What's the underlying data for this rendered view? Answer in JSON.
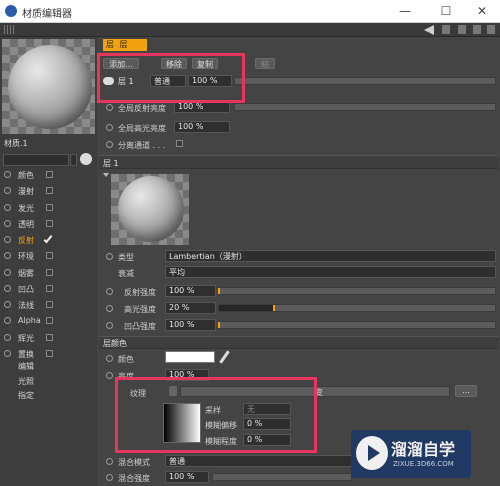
{
  "window": {
    "title": "材质编辑器",
    "controls": [
      "—",
      "☐",
      "✕"
    ]
  },
  "material": {
    "name": "材质.1"
  },
  "channels": [
    {
      "label": "颜色",
      "checked": false,
      "active": false
    },
    {
      "label": "漫射",
      "checked": false,
      "active": false
    },
    {
      "label": "发光",
      "checked": false,
      "active": false
    },
    {
      "label": "透明",
      "checked": false,
      "active": false
    },
    {
      "label": "反射",
      "checked": true,
      "active": true
    },
    {
      "label": "环境",
      "checked": false,
      "active": false
    },
    {
      "label": "烟雾",
      "checked": false,
      "active": false
    },
    {
      "label": "凹凸",
      "checked": false,
      "active": false
    },
    {
      "label": "法线",
      "checked": false,
      "active": false
    },
    {
      "label": "Alpha",
      "checked": false,
      "active": false
    },
    {
      "label": "辉光",
      "checked": false,
      "active": false
    },
    {
      "label": "置换",
      "checked": false,
      "active": false
    }
  ],
  "extra_items": [
    "编辑",
    "光照",
    "指定"
  ],
  "top_tab": {
    "label": "层"
  },
  "layer_buttons": {
    "add": "添加...",
    "remove": "移除",
    "copy": "复制",
    "paste": "粘"
  },
  "layer_row": {
    "name": "层 1",
    "mode": "普通",
    "percent": "100 %"
  },
  "global": {
    "reflect_brightness_label": "全局反射亮度",
    "reflect_brightness_value": "100 %",
    "spec_brightness_label": "全局高光亮度",
    "spec_brightness_value": "100 %",
    "separate_pass_label": "分离通道 . . ."
  },
  "layer_section": {
    "title": "层 1"
  },
  "props": {
    "type_label": "类型",
    "type_value": "Lambertian（漫射）",
    "attenuation_label": "衰减",
    "attenuation_value": "平均",
    "reflect_strength_label": "反射强度",
    "reflect_strength_value": "100 %",
    "reflect_strength_level": 0,
    "spec_strength_label": "高光强度",
    "spec_strength_value": "20 %",
    "spec_strength_level": 0.2,
    "bump_strength_label": "凹凸强度",
    "bump_strength_value": "100 %",
    "bump_strength_level": 0
  },
  "layer_color": {
    "title": "层颜色",
    "color_label": "颜色",
    "color_swatch": "#ffffff",
    "brightness_label": "亮度",
    "brightness_value": "100 %",
    "texture_label": "纹理",
    "texture_right_label": "变",
    "sampling_label": "采样",
    "sampling_value": "无",
    "blur_offset_label": "模糊偏移",
    "blur_offset_value": "0 %",
    "blur_scale_label": "模糊程度",
    "blur_scale_value": "0 %",
    "mix_mode_label": "混合模式",
    "mix_mode_value": "普通",
    "mix_strength_label": "混合强度",
    "mix_strength_value": "100 %"
  },
  "watermark": {
    "title": "溜溜自学",
    "url": "ZIXUE.3D66.COM"
  },
  "colors": {
    "accent": "#f2a20c",
    "highlight": "#e8355e",
    "active_channel": "#f2a20c"
  }
}
